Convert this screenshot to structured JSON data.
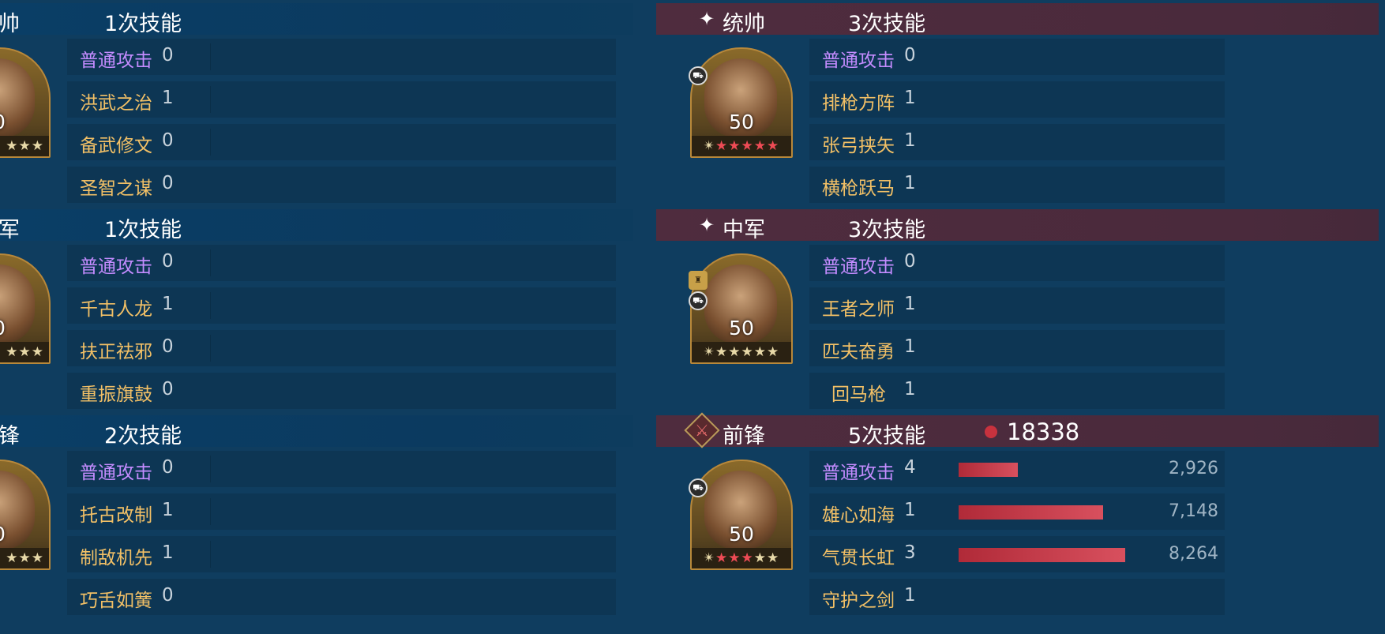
{
  "colors": {
    "background": "#0f3d5f",
    "left_header": "#0b3a5f",
    "right_header": "#4a2a3c",
    "basic_attack": "#c48cff",
    "skill_name": "#f2c066",
    "damage_bar": "#c8323e"
  },
  "left": {
    "sections": [
      {
        "role": "帅",
        "count": "1次技能",
        "portrait": {
          "level": "0",
          "stars": "★★★"
        },
        "skills": [
          {
            "name": "普通攻击",
            "count": "0"
          },
          {
            "name": "洪武之治",
            "count": "1"
          },
          {
            "name": "备武修文",
            "count": "0"
          },
          {
            "name": "圣智之谋",
            "count": "0"
          }
        ]
      },
      {
        "role": "军",
        "count": "1次技能",
        "portrait": {
          "level": "0",
          "stars": "★★★"
        },
        "skills": [
          {
            "name": "普通攻击",
            "count": "0"
          },
          {
            "name": "千古人龙",
            "count": "1"
          },
          {
            "name": "扶正祛邪",
            "count": "0"
          },
          {
            "name": "重振旗鼓",
            "count": "0"
          }
        ]
      },
      {
        "role": "锋",
        "count": "2次技能",
        "portrait": {
          "level": "0",
          "stars": "★★★"
        },
        "skills": [
          {
            "name": "普通攻击",
            "count": "0"
          },
          {
            "name": "托古改制",
            "count": "1"
          },
          {
            "name": "制敌机先",
            "count": "1"
          },
          {
            "name": "巧舌如簧",
            "count": "0"
          }
        ]
      }
    ]
  },
  "right": {
    "sections": [
      {
        "role": "统帅",
        "count": "3次技能",
        "icon": "star-burst-icon",
        "portrait": {
          "level": "50",
          "stars_red": 5,
          "stars_total": 5,
          "badges": [
            "chariot-icon"
          ]
        },
        "skills": [
          {
            "name": "普通攻击",
            "count": "0"
          },
          {
            "name": "排枪方阵",
            "count": "1"
          },
          {
            "name": "张弓挟矢",
            "count": "1"
          },
          {
            "name": "横枪跃马",
            "count": "1"
          }
        ]
      },
      {
        "role": "中军",
        "count": "3次技能",
        "icon": "star-burst-icon",
        "portrait": {
          "level": "50",
          "stars_red": 0,
          "stars_total": 5,
          "badges": [
            "helmet-icon",
            "chariot-icon"
          ]
        },
        "skills": [
          {
            "name": "普通攻击",
            "count": "0"
          },
          {
            "name": "王者之师",
            "count": "1"
          },
          {
            "name": "匹夫奋勇",
            "count": "1"
          },
          {
            "name": "回马枪",
            "count": "1"
          }
        ]
      },
      {
        "role": "前锋",
        "count": "5次技能",
        "icon": "sword-diamond-icon",
        "damage_total": "18338",
        "portrait": {
          "level": "50",
          "stars_red": 3,
          "stars_total": 5,
          "badges": [
            "tank-icon"
          ]
        },
        "skills": [
          {
            "name": "普通攻击",
            "count": "4",
            "damage": "2,926",
            "damage_value": 2926
          },
          {
            "name": "雄心如海",
            "count": "1",
            "damage": "7,148",
            "damage_value": 7148
          },
          {
            "name": "气贯长虹",
            "count": "3",
            "damage": "8,264",
            "damage_value": 8264
          },
          {
            "name": "守护之剑",
            "count": "1"
          }
        ]
      }
    ]
  }
}
